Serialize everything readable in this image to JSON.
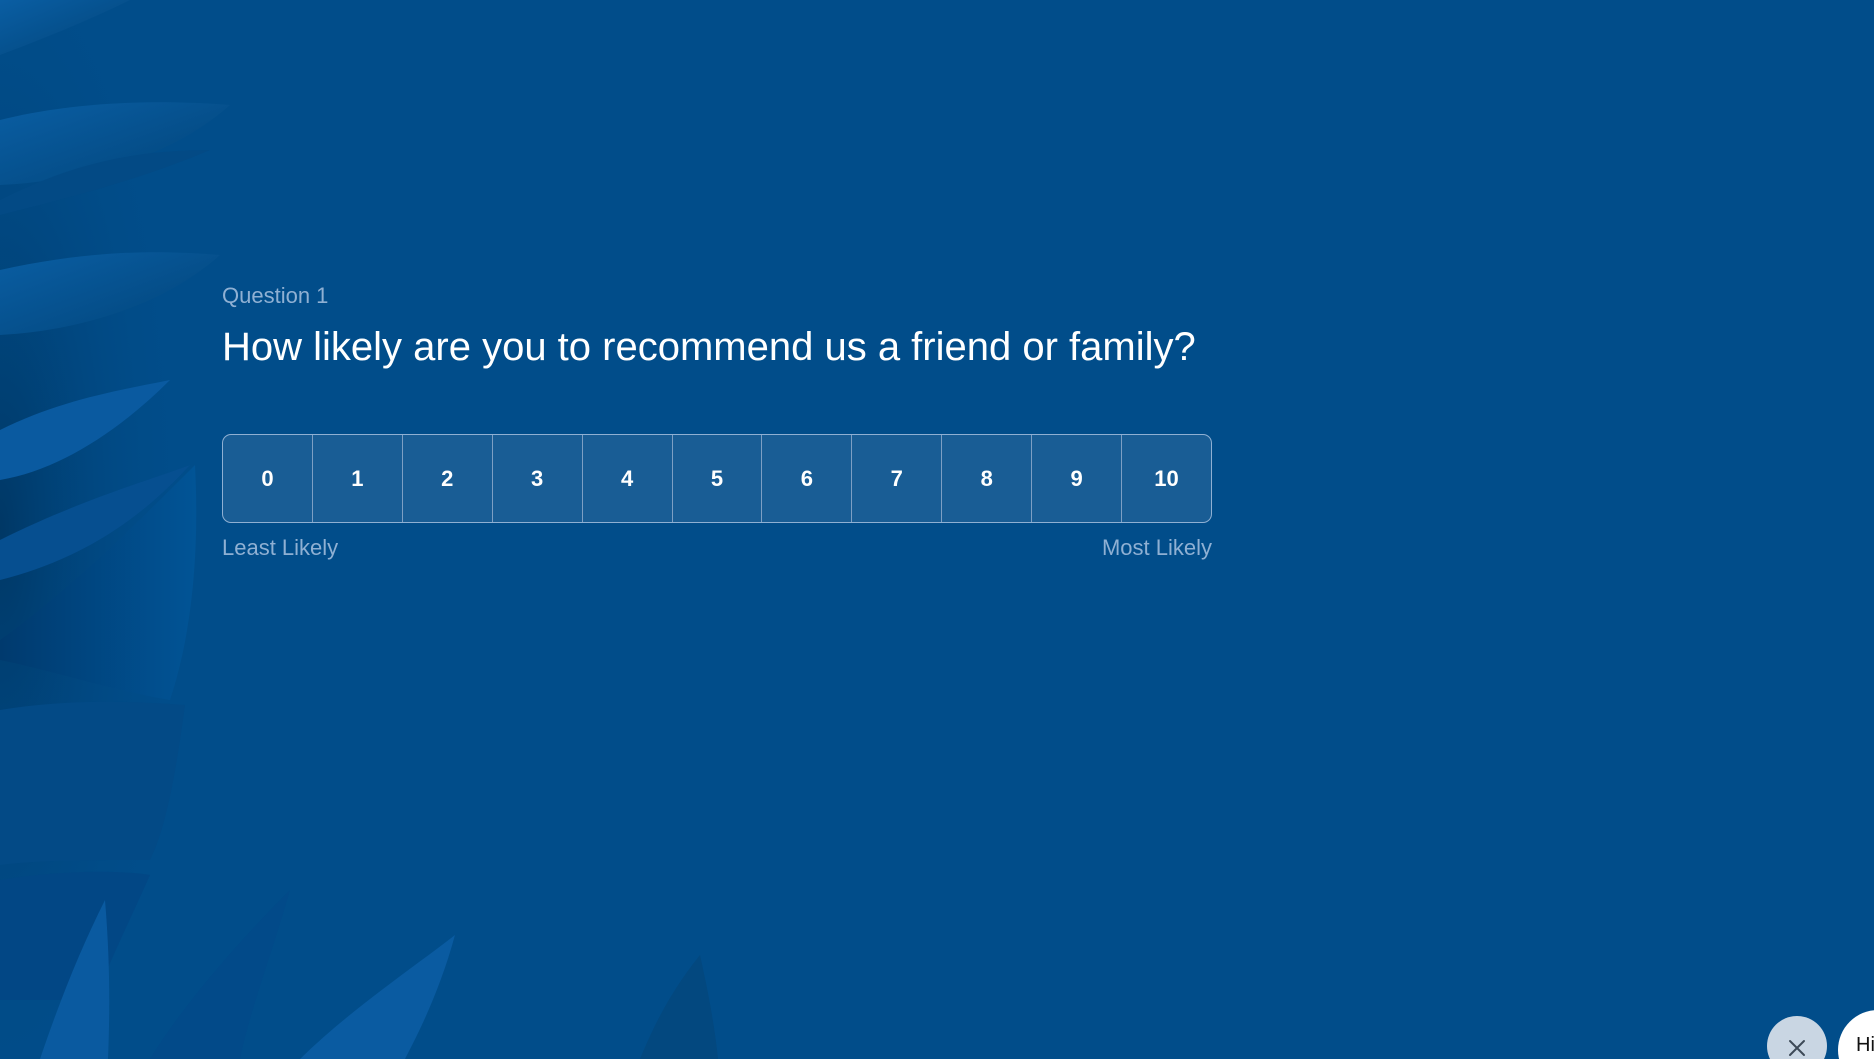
{
  "question": {
    "number_label": "Question 1",
    "text": "How likely are you to recommend us a friend or family?"
  },
  "scale": {
    "options": [
      "0",
      "1",
      "2",
      "3",
      "4",
      "5",
      "6",
      "7",
      "8",
      "9",
      "10"
    ],
    "min_label": "Least Likely",
    "max_label": "Most Likely"
  },
  "widget": {
    "close_icon": "close-icon",
    "chat_text": "Hi"
  },
  "colors": {
    "background": "#014d8a",
    "secondary_text": "#8fb0d3",
    "primary_text": "#ffffff"
  }
}
